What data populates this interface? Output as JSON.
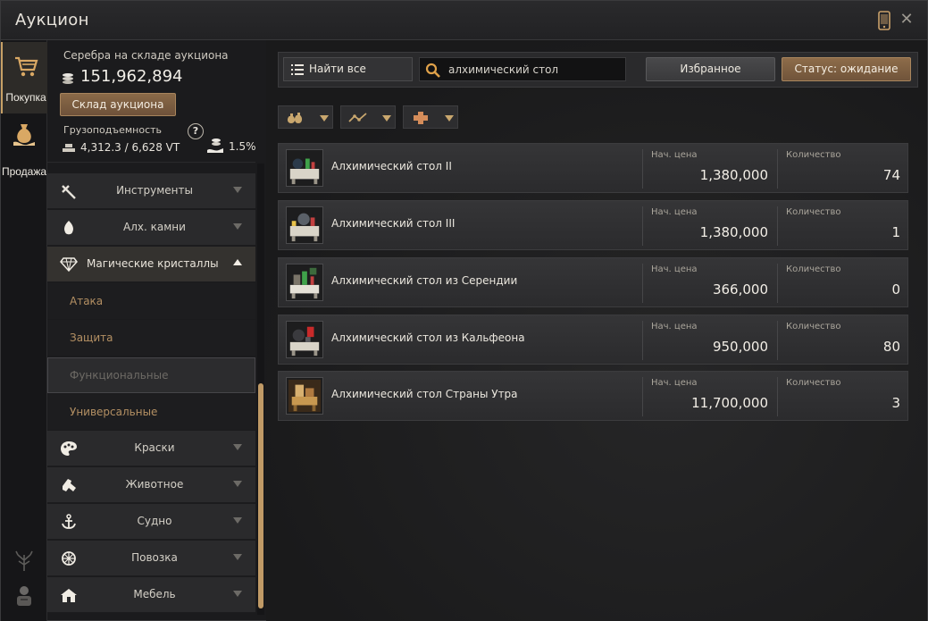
{
  "window": {
    "title": "Аукцион"
  },
  "rail": {
    "tabs": [
      {
        "label": "Покупка",
        "icon": "cart-icon",
        "active": true
      },
      {
        "label": "Продажа",
        "icon": "money-bag-icon",
        "active": false
      }
    ]
  },
  "wallet": {
    "silver_label": "Серебра на складе аукциона",
    "silver_value": "151,962,894",
    "warehouse_button": "Склад аукциона",
    "weight_label": "Грузоподъемность",
    "weight_value": "4,312.3 / 6,628 VT",
    "tax_value": "1.5%"
  },
  "categories": [
    {
      "label": "Инструменты",
      "icon": "tools-icon"
    },
    {
      "label": "Алх. камни",
      "icon": "alchemy-stone-icon"
    },
    {
      "label": "Магические кристаллы",
      "icon": "crystal-icon",
      "open": true,
      "subs": [
        "Атака",
        "Защита",
        "Функциональные",
        "Универсальные"
      ],
      "selected_sub": 2
    },
    {
      "label": "Краски",
      "icon": "palette-icon"
    },
    {
      "label": "Животное",
      "icon": "animal-icon"
    },
    {
      "label": "Судно",
      "icon": "anchor-icon"
    },
    {
      "label": "Повозка",
      "icon": "wheel-icon"
    },
    {
      "label": "Мебель",
      "icon": "house-icon"
    }
  ],
  "search": {
    "find_all_label": "Найти все",
    "query": "алхимический стол",
    "favorites_label": "Избранное",
    "status_label": "Статус: ожидание"
  },
  "filters": [
    {
      "icon": "money-bags-icon"
    },
    {
      "icon": "trend-icon"
    },
    {
      "icon": "plus-icon"
    }
  ],
  "columns": {
    "price": "Нач. цена",
    "qty": "Количество"
  },
  "results": [
    {
      "name": "Алхимический стол II",
      "price": "1,380,000",
      "qty": "74"
    },
    {
      "name": "Алхимический стол III",
      "price": "1,380,000",
      "qty": "1"
    },
    {
      "name": "Алхимический стол из Серендии",
      "price": "366,000",
      "qty": "0"
    },
    {
      "name": "Алхимический стол из Кальфеона",
      "price": "950,000",
      "qty": "80"
    },
    {
      "name": "Алхимический стол Страны Утра",
      "price": "11,700,000",
      "qty": "3"
    }
  ],
  "colors": {
    "accent": "#c09a66",
    "button_brown": "#7e5f42",
    "panel": "#2a2a2c"
  }
}
